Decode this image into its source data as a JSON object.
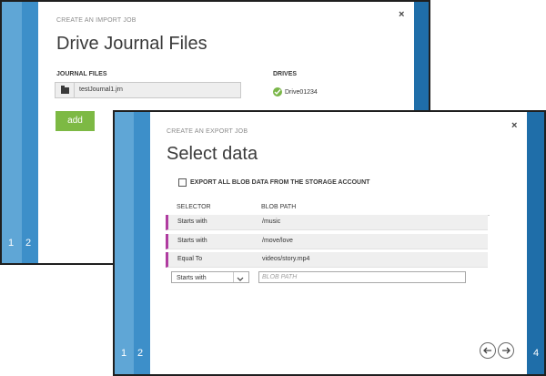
{
  "colors": {
    "strip_blue_light": "#5fa6d6",
    "strip_blue_dark": "#2b7dba",
    "right_strip": "#1f6ea9",
    "add_green": "#7db944",
    "row_accent": "#b03ca0",
    "check_green": "#7ab648"
  },
  "import_dialog": {
    "caption": "CREATE AN IMPORT JOB",
    "title": "Drive Journal Files",
    "journal_files_label": "JOURNAL FILES",
    "journal_file_name": "testJournal1.jrn",
    "drives_label": "DRIVES",
    "drive_name": "Drive01234",
    "add_label": "add",
    "close_label": "×",
    "steps": [
      "1",
      "2"
    ]
  },
  "export_dialog": {
    "caption": "CREATE AN EXPORT JOB",
    "title": "Select data",
    "export_all_label": "EXPORT ALL BLOB DATA FROM THE STORAGE ACCOUNT",
    "selector_header": "SELECTOR",
    "blob_path_header": "BLOB PATH",
    "rows": [
      {
        "selector": "Starts with",
        "path": "/music"
      },
      {
        "selector": "Starts with",
        "path": "/move/love"
      },
      {
        "selector": "Equal To",
        "path": "videos/story.mp4"
      }
    ],
    "new_row_selector": "Starts with",
    "blob_path_placeholder": "BLOB PATH",
    "close_label": "×",
    "steps": [
      "1",
      "2"
    ],
    "right_step": "4"
  }
}
